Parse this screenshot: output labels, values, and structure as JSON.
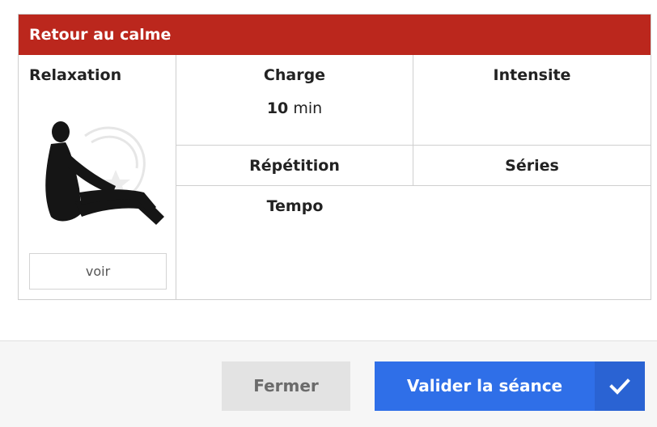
{
  "block": {
    "title": "Retour au calme",
    "color": "#bb271d"
  },
  "exercise": {
    "name": "Relaxation",
    "illustration_icon": "seated-stretch-figure-icon",
    "view_label": "voir"
  },
  "params": {
    "charge": {
      "label": "Charge",
      "value": "10",
      "unit": "min"
    },
    "intensite": {
      "label": "Intensite"
    },
    "repetition": {
      "label": "Répétition"
    },
    "series": {
      "label": "Séries"
    },
    "tempo": {
      "label": "Tempo"
    }
  },
  "footer": {
    "close_label": "Fermer",
    "validate_label": "Valider la séance",
    "validate_icon": "checkmark-icon",
    "accent_color": "#2f6fe8"
  }
}
